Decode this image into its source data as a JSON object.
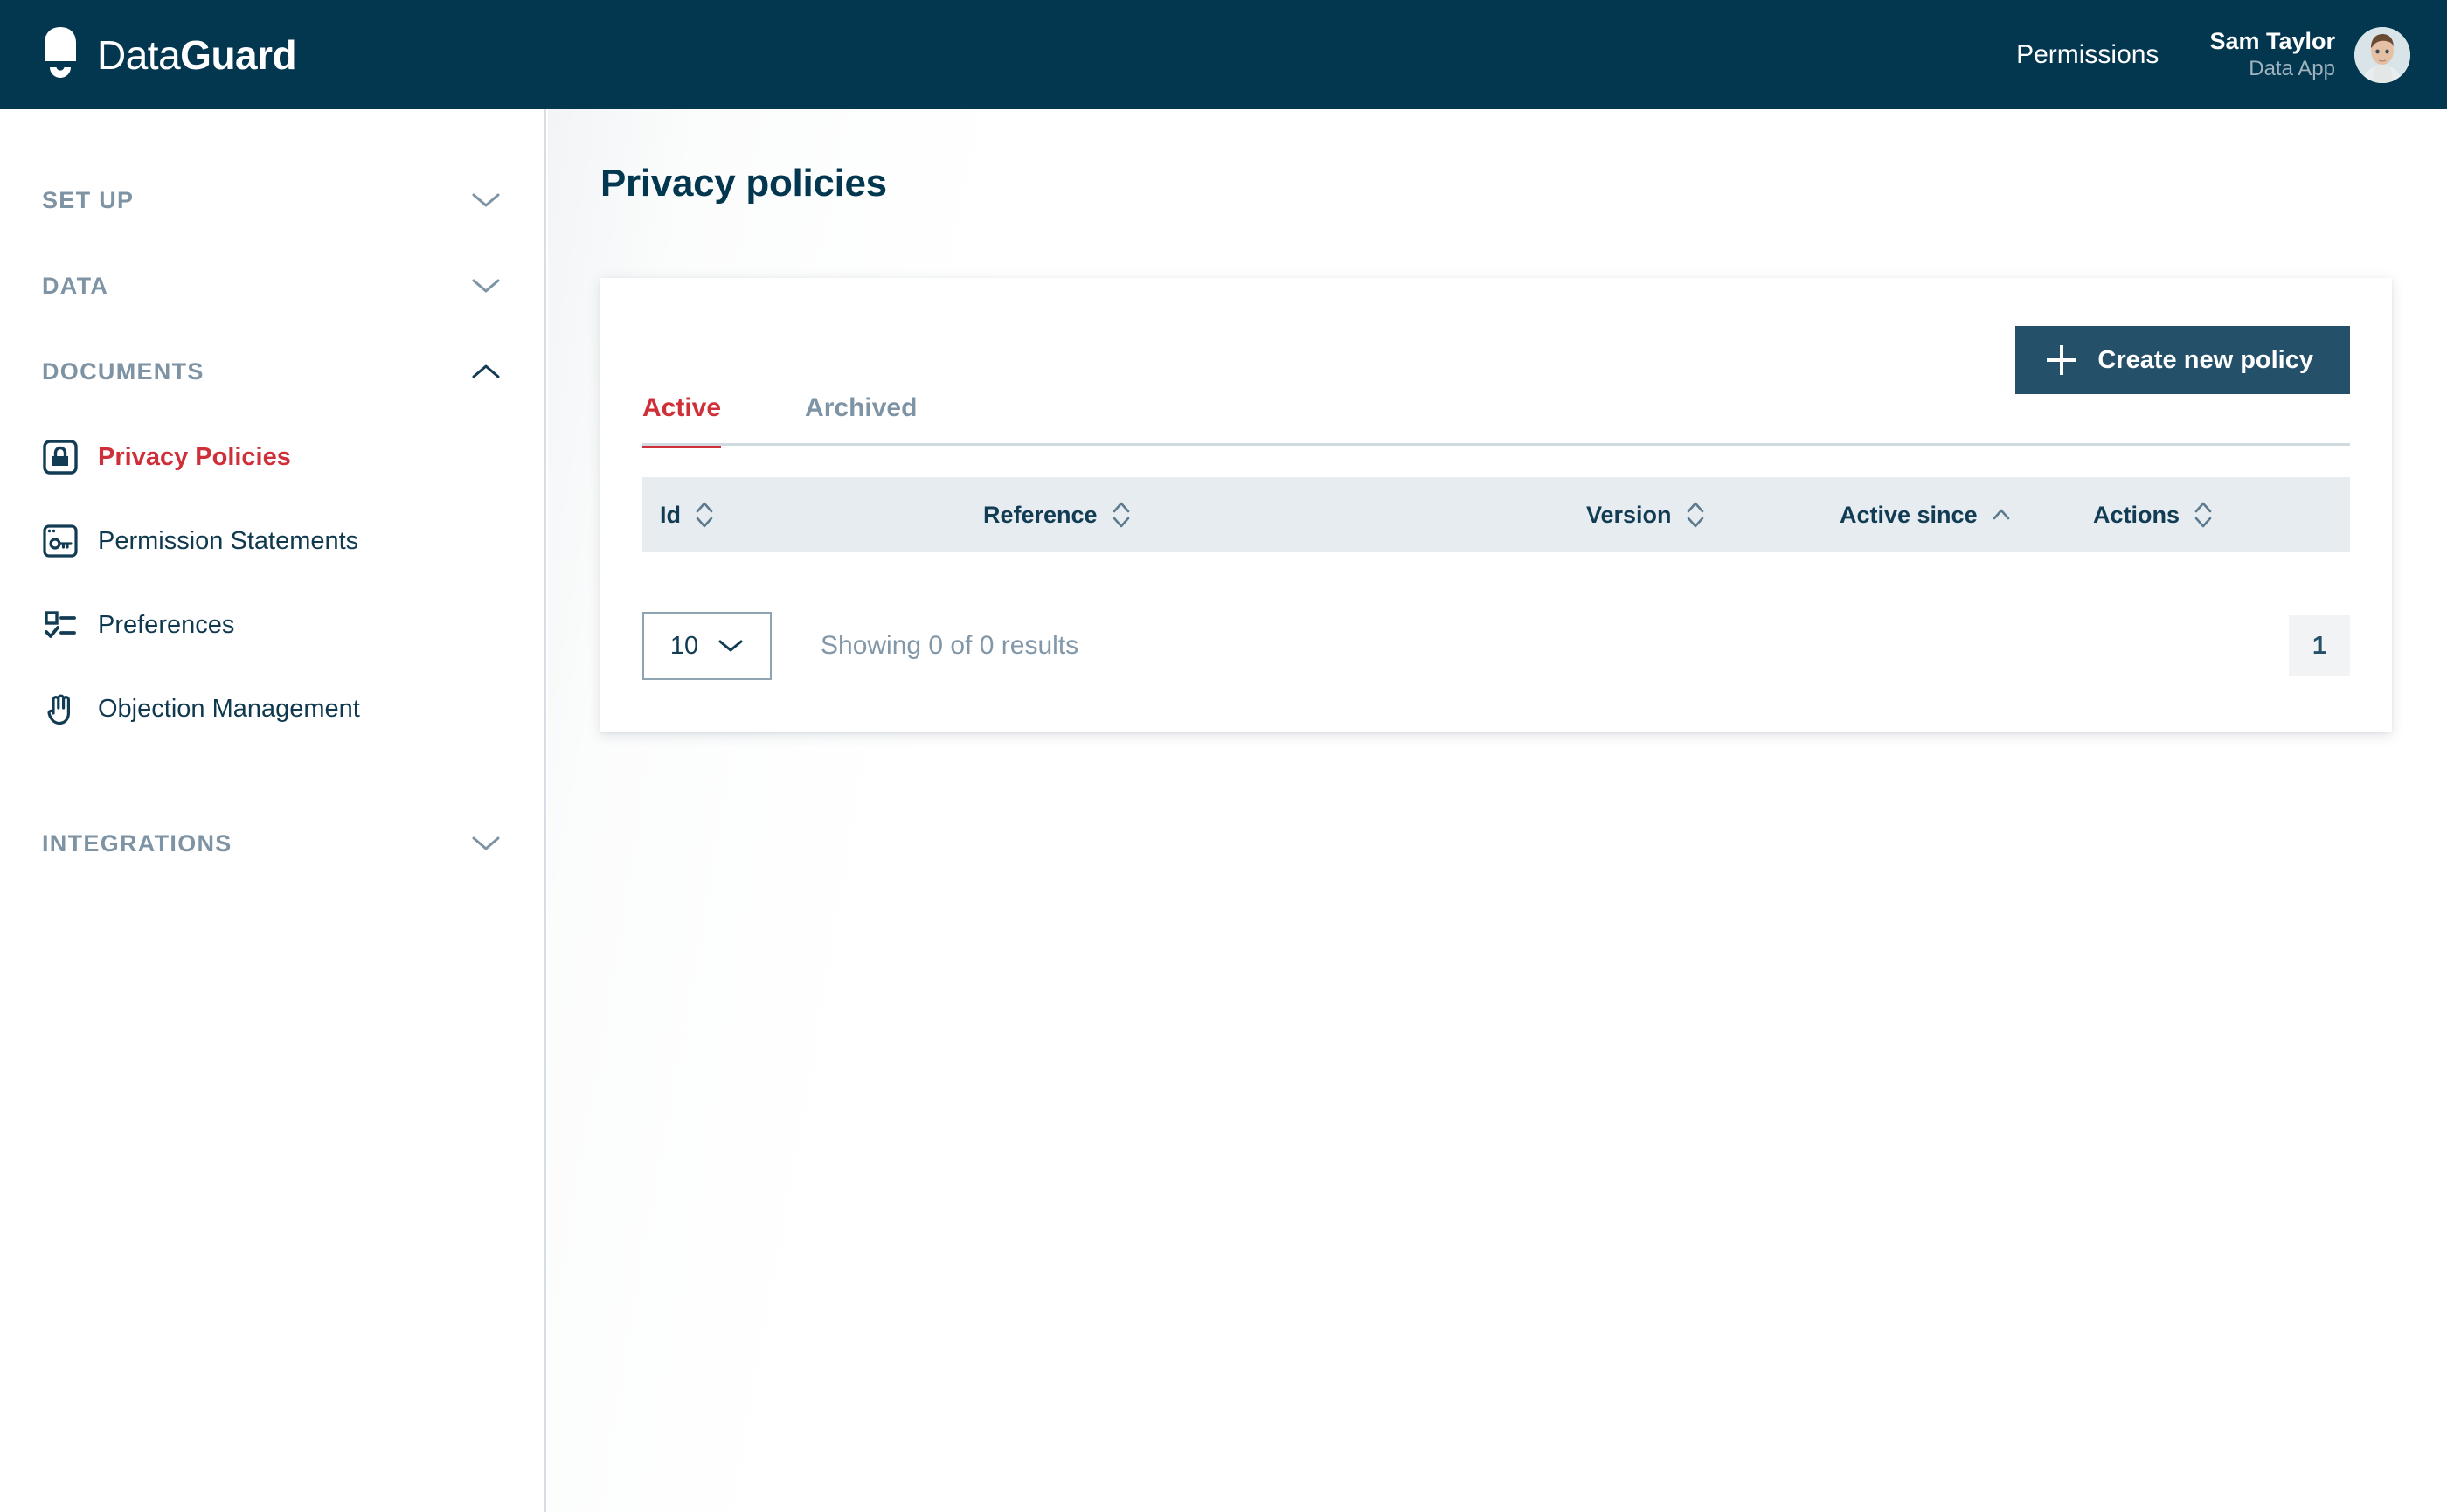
{
  "brand": {
    "name_light": "Data",
    "name_bold": "Guard",
    "logo_icon": "shield-droplet-icon"
  },
  "topbar": {
    "nav_link": "Permissions",
    "user": {
      "name": "Sam Taylor",
      "role": "Data App",
      "avatar_icon": "user-avatar-photo"
    }
  },
  "sidebar": {
    "sections": [
      {
        "label": "SET UP",
        "expanded": false,
        "chevron": "chevron-down-icon"
      },
      {
        "label": "DATA",
        "expanded": false,
        "chevron": "chevron-down-icon"
      },
      {
        "label": "DOCUMENTS",
        "expanded": true,
        "chevron": "chevron-up-icon"
      },
      {
        "label": "INTEGRATIONS",
        "expanded": false,
        "chevron": "chevron-down-icon"
      }
    ],
    "documents_items": [
      {
        "label": "Privacy Policies",
        "icon": "lock-square-icon",
        "active": true
      },
      {
        "label": "Permission Statements",
        "icon": "key-window-icon",
        "active": false
      },
      {
        "label": "Preferences",
        "icon": "checklist-icon",
        "active": false
      },
      {
        "label": "Objection Management",
        "icon": "hand-stop-icon",
        "active": false
      }
    ]
  },
  "main": {
    "page_title": "Privacy policies",
    "tabs": [
      {
        "label": "Active",
        "selected": true
      },
      {
        "label": "Archived",
        "selected": false
      }
    ],
    "create_button": {
      "label": "Create new policy",
      "icon": "plus-icon"
    },
    "table": {
      "columns": [
        {
          "label": "Id",
          "sort": "none"
        },
        {
          "label": "Reference",
          "sort": "none"
        },
        {
          "label": "Version",
          "sort": "none"
        },
        {
          "label": "Active since",
          "sort": "asc"
        },
        {
          "label": "Actions",
          "sort": "none"
        }
      ],
      "rows": []
    },
    "footer": {
      "page_size": "10",
      "page_size_chevron": "chevron-down-icon",
      "results_text": "Showing 0 of 0 results",
      "pages": [
        "1"
      ]
    }
  },
  "colors": {
    "topbar_bg": "#03374f",
    "accent_red": "#cf2f38",
    "button_blue": "#25506a",
    "muted": "#7e93a3",
    "table_header_bg": "#e6ecf0"
  }
}
